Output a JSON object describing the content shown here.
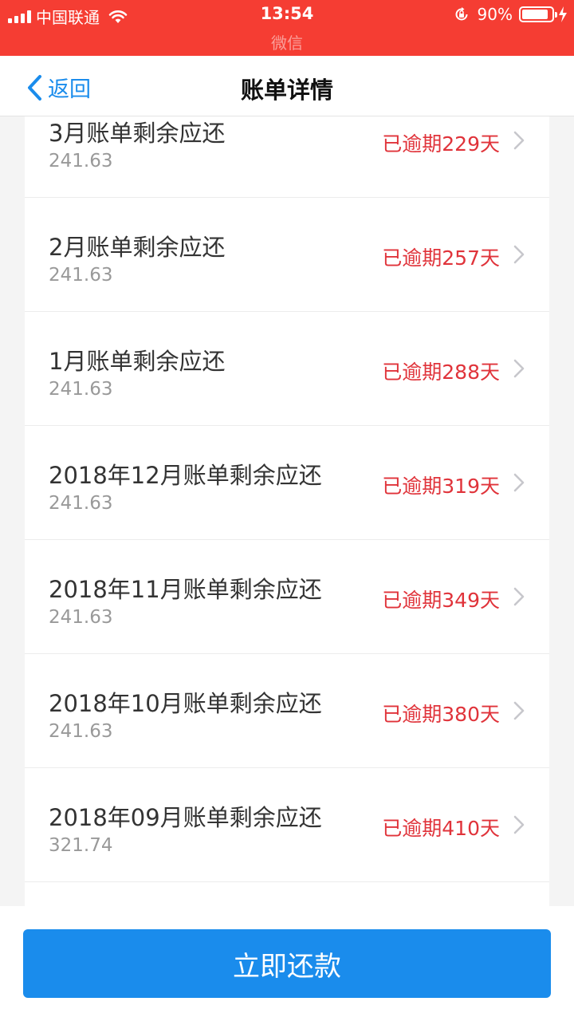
{
  "status_bar": {
    "carrier": "中国联通",
    "time": "13:54",
    "app_name": "微信",
    "battery": "90%",
    "battery_level": 0.9
  },
  "nav": {
    "back_label": "返回",
    "title": "账单详情"
  },
  "bills": [
    {
      "title": "3月账单剩余应还",
      "amount": "241.63",
      "status": "已逾期229天"
    },
    {
      "title": "2月账单剩余应还",
      "amount": "241.63",
      "status": "已逾期257天"
    },
    {
      "title": "1月账单剩余应还",
      "amount": "241.63",
      "status": "已逾期288天"
    },
    {
      "title": "2018年12月账单剩余应还",
      "amount": "241.63",
      "status": "已逾期319天"
    },
    {
      "title": "2018年11月账单剩余应还",
      "amount": "241.63",
      "status": "已逾期349天"
    },
    {
      "title": "2018年10月账单剩余应还",
      "amount": "241.63",
      "status": "已逾期380天"
    },
    {
      "title": "2018年09月账单剩余应还",
      "amount": "321.74",
      "status": "已逾期410天"
    }
  ],
  "footer": {
    "pay_label": "立即还款"
  },
  "colors": {
    "status_bar": "#f53d33",
    "accent": "#1a8cec",
    "overdue": "#e0333a"
  }
}
